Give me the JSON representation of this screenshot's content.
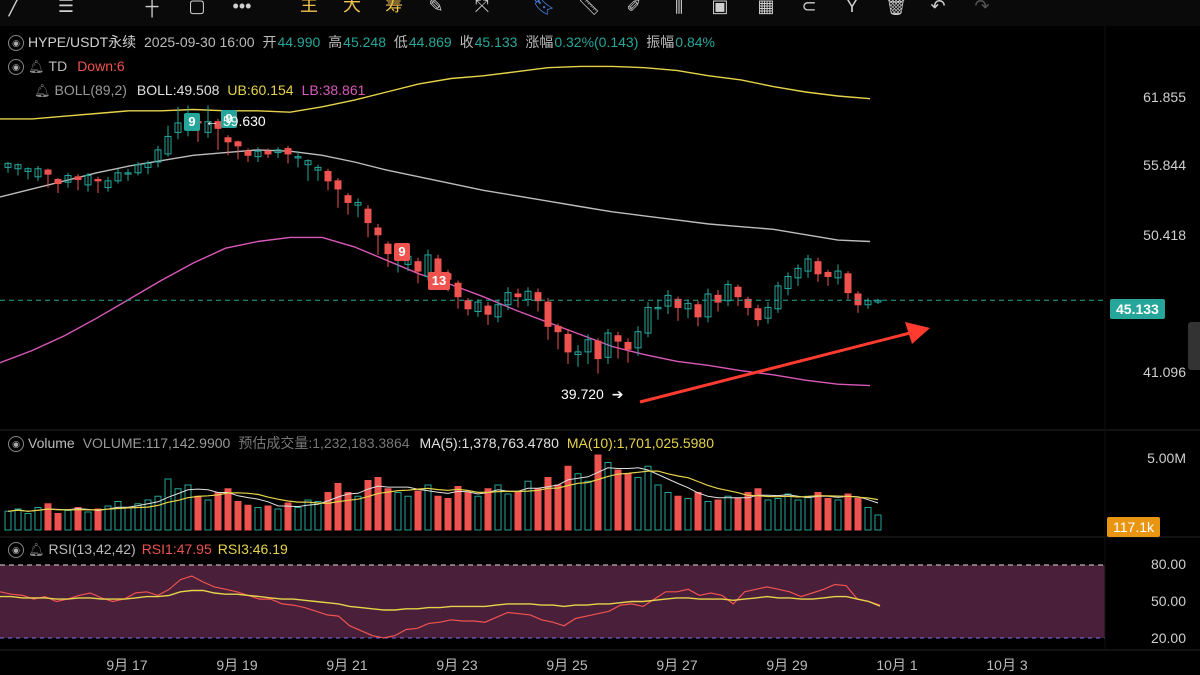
{
  "toolbar": {
    "icons": [
      "line-tool-icon",
      "menu-icon",
      "horizontal-line-icon",
      "rectangle-icon",
      "more-icon"
    ],
    "ind1": "主",
    "ind2": "大",
    "ind3": "筹",
    "icons2": [
      "edit-icon",
      "crosshair-icon",
      "bookmark-icon",
      "ruler-icon",
      "pen-icon",
      "candles-icon",
      "calendar-icon",
      "calendar-grid-icon",
      "magnet-icon",
      "fork-icon",
      "trash-icon",
      "undo-icon",
      "redo-icon"
    ]
  },
  "header": {
    "symbol": "HYPE/USDT永续",
    "datetime": "2025-09-30 16:00",
    "open_label": "开",
    "open": "44.990",
    "high_label": "高",
    "high": "45.248",
    "low_label": "低",
    "low": "44.869",
    "close_label": "收",
    "close": "45.133",
    "change_label": "涨幅",
    "change": "0.32%(0.143)",
    "amp_label": "振幅",
    "amp": "0.84%"
  },
  "td": {
    "label": "TD",
    "down": "Down:6"
  },
  "boll": {
    "label": "BOLL(89,2)",
    "mid": "BOLL:49.508",
    "ub": "UB:60.154",
    "lb": "LB:38.861"
  },
  "price_axis": {
    "p1": "61.855",
    "p2": "55.844",
    "p3": "50.418",
    "p4": "41.096",
    "current": "45.133"
  },
  "annotations": {
    "high_mark": "59.630",
    "low_mark": "39.720",
    "td9_up": "9",
    "td9_up2": "9",
    "td9_down": "9",
    "td13": "13"
  },
  "volume": {
    "label": "Volume",
    "vol": "VOLUME:117,142.9900",
    "est": "预估成交量:1,232,183.3864",
    "ma5": "MA(5):1,378,763.4780",
    "ma10": "MA(10):1,701,025.5980",
    "axis_top": "5.00M",
    "current": "117.1k"
  },
  "rsi": {
    "label": "RSI(13,42,42)",
    "rsi1": "RSI1:47.95",
    "rsi3": "RSI3:46.19",
    "l80": "80.00",
    "l50": "50.00",
    "l20": "20.00"
  },
  "xaxis": [
    "9月 17",
    "9月 19",
    "9月 21",
    "9月 23",
    "9月 25",
    "9月 27",
    "9月 29",
    "10月 1",
    "10月 3"
  ],
  "colors": {
    "up": "#26a69a",
    "down": "#ef5350",
    "boll_ub": "#e6d34a",
    "boll_mid": "#bdbdbd",
    "boll_lb": "#d958b8",
    "accent": "#f2c14e",
    "arrow": "#ff3b30"
  },
  "chart_data": {
    "type": "candlestick",
    "candles": [
      [
        55.0,
        55.3,
        54.8,
        55.4,
        54.6
      ],
      [
        54.9,
        55.2,
        54.6,
        55.3,
        54.4
      ],
      [
        54.7,
        54.9,
        54.3,
        55.0,
        54.1
      ],
      [
        54.3,
        54.9,
        54.2,
        55.1,
        54.0
      ],
      [
        54.8,
        54.5,
        53.7,
        54.9,
        53.5
      ],
      [
        54.1,
        53.8,
        53.4,
        54.2,
        53.1
      ],
      [
        53.9,
        54.4,
        53.6,
        54.6,
        53.5
      ],
      [
        54.3,
        54.1,
        53.5,
        54.5,
        53.3
      ],
      [
        53.7,
        54.4,
        53.5,
        54.6,
        53.2
      ],
      [
        54.1,
        54.0,
        53.3,
        54.3,
        53.1
      ],
      [
        53.5,
        54.0,
        53.4,
        54.3,
        53.2
      ],
      [
        54.0,
        54.6,
        53.9,
        54.9,
        53.8
      ],
      [
        54.5,
        54.6,
        54.2,
        54.9,
        54.0
      ],
      [
        54.6,
        55.2,
        54.5,
        55.4,
        54.4
      ],
      [
        55.0,
        55.3,
        54.7,
        55.5,
        54.5
      ],
      [
        55.4,
        56.3,
        55.3,
        56.6,
        55.0
      ],
      [
        56.0,
        57.3,
        55.9,
        58.1,
        55.8
      ],
      [
        57.6,
        58.3,
        57.4,
        59.5,
        57.1
      ],
      [
        58.3,
        58.5,
        57.8,
        59.6,
        57.3
      ],
      [
        58.4,
        58.3,
        57.2,
        58.9,
        56.9
      ],
      [
        57.6,
        58.4,
        57.5,
        59.6,
        57.2
      ],
      [
        58.4,
        57.9,
        56.6,
        58.6,
        56.3
      ],
      [
        57.2,
        56.9,
        56.3,
        57.4,
        55.9
      ],
      [
        56.9,
        56.6,
        56.0,
        57.0,
        55.6
      ],
      [
        56.2,
        55.9,
        55.7,
        56.4,
        55.4
      ],
      [
        55.8,
        56.2,
        55.6,
        56.5,
        55.4
      ],
      [
        56.2,
        56.0,
        55.9,
        56.4,
        55.7
      ],
      [
        56.1,
        56.3,
        55.9,
        56.5,
        55.7
      ],
      [
        56.4,
        56.0,
        55.6,
        56.6,
        55.3
      ],
      [
        55.7,
        55.8,
        55.2,
        56.2,
        55.0
      ],
      [
        55.2,
        55.5,
        54.2,
        55.6,
        54.0
      ],
      [
        54.8,
        55.0,
        54.2,
        55.2,
        54.0
      ],
      [
        54.7,
        54.0,
        53.7,
        54.9,
        53.3
      ],
      [
        54.0,
        53.4,
        52.3,
        54.2,
        52.0
      ],
      [
        52.9,
        52.4,
        51.7,
        53.1,
        51.5
      ],
      [
        52.2,
        52.4,
        51.6,
        52.7,
        51.3
      ],
      [
        51.9,
        50.9,
        50.0,
        52.2,
        49.8
      ],
      [
        50.5,
        50.0,
        48.9,
        50.8,
        48.5
      ],
      [
        49.3,
        48.6,
        47.9,
        49.5,
        47.6
      ],
      [
        48.2,
        48.3,
        47.4,
        48.8,
        47.2
      ],
      [
        47.8,
        48.4,
        47.6,
        48.6,
        47.3
      ],
      [
        48.0,
        47.3,
        46.7,
        48.3,
        46.4
      ],
      [
        46.9,
        48.5,
        46.8,
        48.9,
        46.6
      ],
      [
        48.2,
        47.0,
        46.3,
        48.5,
        46.0
      ],
      [
        47.1,
        46.7,
        46.0,
        47.4,
        45.8
      ],
      [
        46.4,
        45.4,
        44.8,
        46.6,
        44.5
      ],
      [
        45.1,
        44.5,
        44.2,
        45.3,
        44.0
      ],
      [
        44.3,
        45.0,
        44.1,
        45.2,
        43.9
      ],
      [
        44.7,
        44.1,
        43.6,
        45.0,
        43.3
      ],
      [
        43.9,
        44.8,
        43.7,
        45.2,
        43.5
      ],
      [
        44.8,
        45.7,
        44.6,
        46.1,
        44.4
      ],
      [
        45.6,
        45.4,
        44.9,
        46.0,
        44.6
      ],
      [
        45.2,
        45.8,
        44.9,
        46.1,
        44.7
      ],
      [
        45.7,
        45.1,
        44.6,
        46.0,
        44.3
      ],
      [
        45.0,
        43.2,
        42.5,
        45.3,
        42.2
      ],
      [
        43.2,
        42.8,
        41.8,
        43.4,
        41.5
      ],
      [
        42.6,
        41.3,
        40.7,
        43.0,
        40.4
      ],
      [
        41.1,
        41.3,
        40.5,
        41.8,
        40.2
      ],
      [
        41.3,
        42.2,
        40.6,
        42.6,
        40.4
      ],
      [
        42.1,
        40.8,
        39.8,
        42.3,
        39.7
      ],
      [
        40.9,
        42.7,
        40.6,
        43.0,
        40.4
      ],
      [
        42.5,
        42.1,
        41.1,
        42.8,
        40.8
      ],
      [
        42.0,
        41.5,
        40.7,
        42.3,
        40.5
      ],
      [
        41.6,
        42.8,
        41.3,
        43.2,
        41.0
      ],
      [
        42.7,
        44.6,
        42.6,
        45.0,
        42.4
      ],
      [
        44.5,
        44.6,
        44.0,
        45.2,
        43.7
      ],
      [
        44.7,
        45.5,
        44.4,
        45.9,
        44.1
      ],
      [
        45.2,
        44.6,
        43.8,
        45.4,
        43.6
      ],
      [
        44.5,
        44.9,
        44.0,
        45.2,
        43.8
      ],
      [
        44.8,
        43.9,
        43.6,
        45.1,
        43.2
      ],
      [
        43.9,
        45.6,
        43.7,
        46.0,
        43.5
      ],
      [
        45.5,
        45.0,
        44.6,
        45.9,
        44.3
      ],
      [
        45.1,
        46.3,
        44.9,
        46.6,
        44.7
      ],
      [
        46.1,
        45.4,
        44.9,
        46.3,
        44.7
      ],
      [
        45.2,
        44.6,
        44.2,
        45.4,
        44.0
      ],
      [
        44.5,
        43.7,
        43.5,
        44.8,
        43.2
      ],
      [
        43.8,
        44.6,
        43.6,
        45.0,
        43.4
      ],
      [
        44.5,
        46.2,
        44.4,
        46.5,
        44.2
      ],
      [
        46.0,
        46.9,
        45.8,
        47.2,
        45.5
      ],
      [
        46.8,
        47.5,
        46.4,
        47.8,
        46.2
      ],
      [
        47.3,
        48.2,
        47.0,
        48.5,
        46.8
      ],
      [
        48.0,
        47.1,
        46.8,
        48.3,
        46.5
      ],
      [
        47.2,
        46.9,
        46.5,
        47.4,
        46.2
      ],
      [
        46.8,
        47.3,
        46.6,
        47.8,
        46.3
      ],
      [
        47.1,
        45.7,
        45.5,
        47.3,
        45.2
      ],
      [
        45.6,
        44.8,
        44.5,
        45.8,
        44.2
      ],
      [
        44.8,
        45.1,
        44.7,
        45.3,
        44.5
      ],
      [
        45.0,
        45.13,
        44.87,
        45.25,
        44.86
      ]
    ],
    "boll_mid": [
      52.8,
      53.4,
      54.0,
      54.6,
      55.1,
      55.5,
      55.9,
      56.1,
      56.3,
      56.2,
      55.9,
      55.4,
      54.8,
      54.3,
      53.8,
      53.3,
      52.9,
      52.5,
      52.1,
      51.7,
      51.4,
      51.1,
      50.8,
      50.6,
      50.4,
      50.0,
      49.6,
      49.5
    ],
    "boll_ub": [
      58.6,
      58.6,
      58.8,
      59.0,
      59.2,
      59.2,
      59.3,
      59.2,
      59.2,
      59.1,
      59.5,
      60.0,
      60.6,
      61.2,
      61.6,
      61.8,
      62.1,
      62.4,
      62.5,
      62.5,
      62.4,
      62.2,
      61.8,
      61.5,
      61.0,
      60.6,
      60.3,
      60.1
    ],
    "boll_lb": [
      40.5,
      41.4,
      42.5,
      43.8,
      45.2,
      46.6,
      47.9,
      49.0,
      49.5,
      49.8,
      49.8,
      49.1,
      48.1,
      47.1,
      46.3,
      45.4,
      44.4,
      43.5,
      42.6,
      41.7,
      41.1,
      40.6,
      40.3,
      39.9,
      39.6,
      39.2,
      38.9,
      38.8
    ],
    "volume_rel": [
      0.25,
      0.28,
      0.22,
      0.3,
      0.35,
      0.22,
      0.26,
      0.3,
      0.24,
      0.28,
      0.32,
      0.38,
      0.3,
      0.35,
      0.4,
      0.45,
      0.68,
      0.55,
      0.6,
      0.45,
      0.4,
      0.5,
      0.55,
      0.38,
      0.33,
      0.3,
      0.32,
      0.28,
      0.36,
      0.3,
      0.4,
      0.38,
      0.5,
      0.62,
      0.5,
      0.45,
      0.66,
      0.7,
      0.55,
      0.5,
      0.45,
      0.52,
      0.6,
      0.45,
      0.42,
      0.58,
      0.5,
      0.45,
      0.55,
      0.6,
      0.48,
      0.5,
      0.65,
      0.55,
      0.7,
      0.6,
      0.85,
      0.75,
      0.65,
      1.0,
      0.9,
      0.8,
      0.75,
      0.7,
      0.85,
      0.6,
      0.5,
      0.45,
      0.42,
      0.5,
      0.38,
      0.4,
      0.45,
      0.42,
      0.5,
      0.55,
      0.4,
      0.42,
      0.48,
      0.4,
      0.45,
      0.5,
      0.42,
      0.4,
      0.48,
      0.42,
      0.3,
      0.2
    ],
    "rsi1": [
      58,
      56,
      55,
      52,
      54,
      50,
      52,
      55,
      57,
      53,
      50,
      52,
      57,
      58,
      55,
      60,
      68,
      71,
      66,
      62,
      60,
      58,
      55,
      52,
      52,
      48,
      47,
      45,
      42,
      39,
      38,
      30,
      26,
      22,
      20,
      22,
      27,
      28,
      32,
      33,
      35,
      34,
      34,
      33,
      37,
      41,
      40,
      39,
      35,
      33,
      30,
      36,
      38,
      40,
      42,
      47,
      48,
      46,
      52,
      58,
      58,
      60,
      55,
      57,
      55,
      48,
      58,
      60,
      62,
      60,
      58,
      54,
      57,
      60,
      64,
      63,
      52,
      50,
      47
    ],
    "rsi3": [
      54,
      54,
      53,
      53,
      53,
      52,
      52,
      53,
      53,
      52,
      52,
      52,
      53,
      54,
      54,
      55,
      58,
      59,
      59,
      57,
      56,
      56,
      55,
      54,
      53,
      52,
      52,
      51,
      50,
      49,
      48,
      46,
      45,
      44,
      43,
      43,
      44,
      44,
      45,
      45,
      46,
      46,
      46,
      46,
      47,
      48,
      48,
      48,
      47,
      47,
      46,
      47,
      47,
      48,
      48,
      49,
      50,
      50,
      51,
      52,
      53,
      53,
      52,
      52,
      52,
      51,
      52,
      53,
      54,
      53,
      53,
      52,
      52,
      53,
      54,
      54,
      52,
      50,
      46.2
    ],
    "price_range": [
      35.5,
      65.5
    ],
    "rsi_range": [
      15,
      85
    ]
  }
}
